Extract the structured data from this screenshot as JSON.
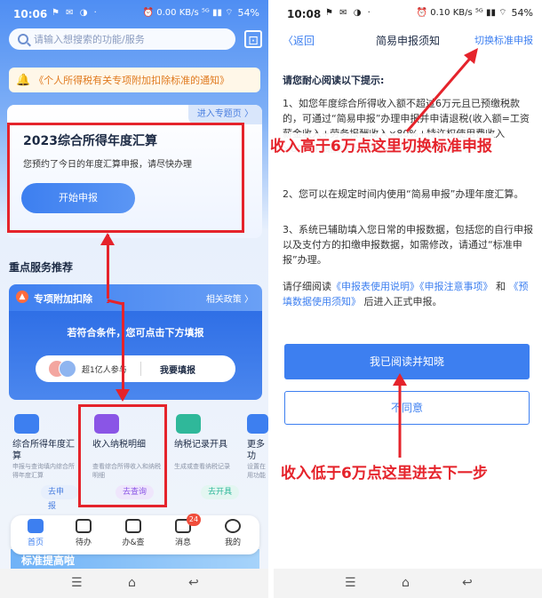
{
  "left": {
    "status": {
      "time": "10:06",
      "left_icons": "⚑ ✉ ◑ ·",
      "right_icons": "⏰ 0.00 KB/s ⁵ᴳ ▮▮ ⌔",
      "battery": "54%"
    },
    "search": {
      "placeholder": "请输入想搜索的功能/服务"
    },
    "notice": "《个人所得税有关专项附加扣除标准的通知》",
    "annual": {
      "enter_topic": "进入专题页 〉",
      "title": "2023综合所得年度汇算",
      "subtitle": "您预约了今日的年度汇算申报，请尽快办理",
      "start_button": "开始申报"
    },
    "section_title": "重点服务推荐",
    "special": {
      "label": "专项附加扣除",
      "policy": "相关政策 〉",
      "message": "若符合条件，您可点击下方填报",
      "participants": "超1亿人参与",
      "fill_button": "我要填报"
    },
    "tiles": [
      {
        "name": "综合所得年度汇算",
        "desc": "申报与查询填内综合所得年度汇算",
        "button": "去申报",
        "color": "#3d7ff0"
      },
      {
        "name": "收入纳税明细",
        "desc": "查看综合所得收入和纳税明细",
        "button": "去查询",
        "color": "#8a55e6"
      },
      {
        "name": "纳税记录开具",
        "desc": "生成或查看纳税记录",
        "button": "去开具",
        "color": "#2fb89a"
      },
      {
        "name": "更多功",
        "desc": "设置在用功能",
        "button": "",
        "color": "#3d7ff0"
      }
    ],
    "nav": [
      {
        "label": "首页",
        "active": true
      },
      {
        "label": "待办",
        "active": false
      },
      {
        "label": "办&查",
        "active": false
      },
      {
        "label": "消息",
        "active": false,
        "badge": "24"
      },
      {
        "label": "我的",
        "active": false
      }
    ],
    "banner": "标准提高啦"
  },
  "right": {
    "status": {
      "time": "10:08",
      "left_icons": "⚑ ✉ ◑ ·",
      "right_icons": "⏰ 0.10 KB/s ⁵ᴳ ▮▮ ⌔",
      "battery": "54%"
    },
    "header": {
      "back": "〈返回",
      "title": "简易申报须知",
      "switch": "切换标准申报"
    },
    "tips_head": "请您耐心阅读以下提示:",
    "tip1": "1、如您年度综合所得收入额不超过6万元且已预缴税款的，可通过“简易申报”办理申报并申请退税(收入额=工资薪金收入+劳务报酬收入×80%+特许权使用费收入×80%+稿酬收入×80%×70%-其他免税收入。",
    "tip2": "2、您可以在规定时间内使用“简易申报”办理年度汇算。",
    "tip3": "3、系统已辅助填入您日常的申报数据，包括您的自行申报以及支付方的扣缴申报数据，如需修改，请通过“标准申报”办理。",
    "tip4_pre": "请仔细阅读",
    "tip4_link1": "《申报表使用说明》",
    "tip4_link2": "《申报注意事项》",
    "tip4_mid": "和",
    "tip4_link3": "《预填数据使用须知》",
    "tip4_post": "后进入正式申报。",
    "read_button": "我已阅读并知晓",
    "disagree_button": "不同意"
  },
  "overlays": {
    "high_income": "收入高于6万点这里切换标准申报",
    "low_income": "收入低于6万点这里进去下一步"
  },
  "sysnav": {
    "menu": "☰",
    "home": "⌂",
    "back": "↩"
  }
}
